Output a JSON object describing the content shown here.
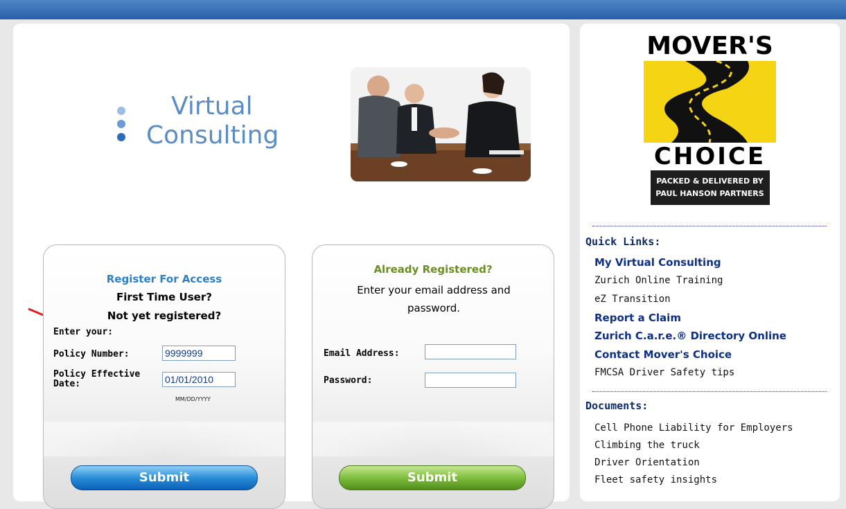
{
  "logo": {
    "line1": "Virtual",
    "line2": "Consulting",
    "color": "#5b8cc6"
  },
  "register": {
    "title": "Register For Access",
    "subtitle1": "First Time User?",
    "subtitle2": "Not yet registered?",
    "enter_your": "Enter your:",
    "policy_label": "Policy Number:",
    "policy_value": "9999999",
    "date_label": "Policy Effective Date:",
    "date_value": "01/01/2010",
    "date_hint": "MM/DD/YYYY",
    "submit_label": "Submit"
  },
  "login": {
    "title": "Already Registered?",
    "instructions": "Enter your email address and password.",
    "email_label": "Email Address:",
    "email_value": "",
    "password_label": "Password:",
    "password_value": "",
    "submit_label": "Submit"
  },
  "sidebar": {
    "brand": {
      "word1": "MOVER'S",
      "word2": "CHOICE",
      "tagline1": "PACKED & DELIVERED BY",
      "tagline2": "PAUL HANSON PARTNERS"
    },
    "quick_links_title": "Quick Links:",
    "quick_links": [
      {
        "label": "My Virtual Consulting",
        "bold": true
      },
      {
        "label": "Zurich Online Training",
        "bold": false
      },
      {
        "label": "eZ Transition",
        "bold": false
      },
      {
        "label": "Report a Claim",
        "bold": true
      },
      {
        "label": "Zurich C.a.r.e.® Directory Online",
        "bold": true
      },
      {
        "label": "Contact Mover's Choice",
        "bold": true
      },
      {
        "label": "FMCSA Driver Safety tips",
        "bold": false
      }
    ],
    "documents_title": "Documents:",
    "documents": [
      {
        "label": "Cell Phone Liability for Employers"
      },
      {
        "label": "Climbing the truck"
      },
      {
        "label": "Driver Orientation"
      },
      {
        "label": "Fleet safety insights"
      }
    ]
  },
  "colors": {
    "topbar": "#3a6fb6",
    "register_title": "#2b7fc6",
    "login_title": "#6b8e23",
    "link_bold": "#0d2f84",
    "brand_yellow": "#f5d414"
  }
}
